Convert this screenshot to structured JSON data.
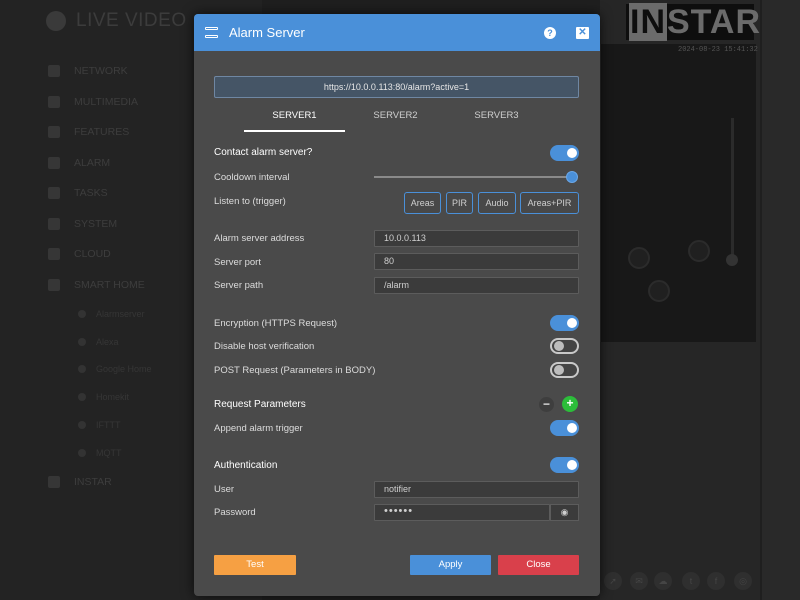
{
  "background": {
    "app_title": "LIVE VIDEO",
    "nav": [
      {
        "label": "NETWORK"
      },
      {
        "label": "MULTIMEDIA"
      },
      {
        "label": "FEATURES"
      },
      {
        "label": "ALARM"
      },
      {
        "label": "TASKS"
      },
      {
        "label": "SYSTEM"
      },
      {
        "label": "CLOUD"
      },
      {
        "label": "SMART HOME"
      }
    ],
    "nav_sub": [
      {
        "label": "Alarmserver"
      },
      {
        "label": "Alexa"
      },
      {
        "label": "Google Home"
      },
      {
        "label": "Homekit"
      },
      {
        "label": "IFTTT"
      },
      {
        "label": "MQTT"
      }
    ],
    "nav_last": "INSTAR",
    "logo": {
      "inv": "IN",
      "rest": "STAR"
    },
    "timestamp": "2024-08-23  15:41:32"
  },
  "dialog": {
    "title": "Alarm Server",
    "help_label": "?",
    "close_label": "✕",
    "url": "https://10.0.0.113:80/alarm?active=1",
    "tabs": [
      {
        "label": "SERVER1",
        "active": true
      },
      {
        "label": "SERVER2",
        "active": false
      },
      {
        "label": "SERVER3",
        "active": false
      }
    ],
    "contact_label": "Contact alarm server?",
    "contact_on": true,
    "cooldown_label": "Cooldown interval",
    "cooldown_level": 1.0,
    "listen_label": "Listen to (trigger)",
    "chips": [
      "Areas",
      "PIR",
      "Audio",
      "Areas+PIR"
    ],
    "address_label": "Alarm server address",
    "address_value": "10.0.0.113",
    "port_label": "Server port",
    "port_value": "80",
    "path_label": "Server path",
    "path_value": "/alarm",
    "encryption_label": "Encryption (HTTPS Request)",
    "encryption_on": true,
    "hostverify_label": "Disable host verification",
    "hostverify_on": false,
    "post_label": "POST Request (Parameters in BODY)",
    "post_on": false,
    "params_label": "Request Parameters",
    "minus_label": "−",
    "plus_label": "+",
    "append_label": "Append alarm trigger",
    "append_on": true,
    "auth_label": "Authentication",
    "auth_on": true,
    "user_label": "User",
    "user_value": "notifier",
    "password_label": "Password",
    "password_value": "••••••",
    "eye_label": "◉",
    "test_label": "Test",
    "apply_label": "Apply",
    "close_button_label": "Close",
    "colors": {
      "accent": "#4a90d9",
      "test": "#f6a043",
      "close": "#d9404b",
      "add": "#2cbd3a"
    }
  }
}
